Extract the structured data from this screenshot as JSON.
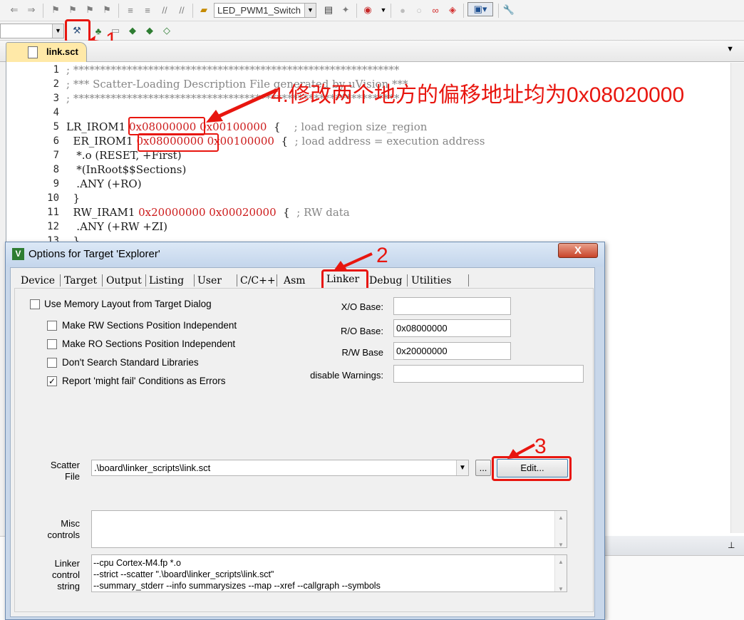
{
  "toolbar": {
    "target_combo": "LED_PWM1_Switch"
  },
  "editor": {
    "tab_label": "link.sct",
    "lines": [
      {
        "num": "1",
        "segments": [
          {
            "t": "; *************************************************************",
            "c": "cm"
          }
        ]
      },
      {
        "num": "2",
        "segments": [
          {
            "t": "; *** Scatter-Loading Description File generated by uVision ***",
            "c": "cm"
          }
        ]
      },
      {
        "num": "3",
        "segments": [
          {
            "t": "; *************************************************************",
            "c": "cm"
          }
        ]
      },
      {
        "num": "4",
        "segments": []
      },
      {
        "num": "5",
        "segments": [
          {
            "t": "LR_IROM1 ",
            "c": ""
          },
          {
            "t": "0x08000000",
            "c": "hx"
          },
          {
            "t": " ",
            "c": ""
          },
          {
            "t": "0x00100000",
            "c": "hx"
          },
          {
            "t": "  {    ",
            "c": ""
          },
          {
            "t": "; load region size_region",
            "c": "cm"
          }
        ]
      },
      {
        "num": "6",
        "segments": [
          {
            "t": "  ER_IROM1 ",
            "c": ""
          },
          {
            "t": "0x08000000",
            "c": "hx"
          },
          {
            "t": " ",
            "c": ""
          },
          {
            "t": "0x00100000",
            "c": "hx"
          },
          {
            "t": "  {  ",
            "c": ""
          },
          {
            "t": "; load address = execution address",
            "c": "cm"
          }
        ]
      },
      {
        "num": "7",
        "segments": [
          {
            "t": "   *.o (RESET, +First)",
            "c": ""
          }
        ]
      },
      {
        "num": "8",
        "segments": [
          {
            "t": "   *(InRoot$$Sections)",
            "c": ""
          }
        ]
      },
      {
        "num": "9",
        "segments": [
          {
            "t": "   .ANY (+RO)",
            "c": ""
          }
        ]
      },
      {
        "num": "10",
        "segments": [
          {
            "t": "  }",
            "c": ""
          }
        ]
      },
      {
        "num": "11",
        "segments": [
          {
            "t": "  RW_IRAM1 ",
            "c": ""
          },
          {
            "t": "0x20000000",
            "c": "hx"
          },
          {
            "t": " ",
            "c": ""
          },
          {
            "t": "0x00020000",
            "c": "hx"
          },
          {
            "t": "  {  ",
            "c": ""
          },
          {
            "t": "; RW data",
            "c": "cm"
          }
        ]
      },
      {
        "num": "12",
        "segments": [
          {
            "t": "   .ANY (+RW +ZI)",
            "c": ""
          }
        ]
      },
      {
        "num": "13",
        "segments": [
          {
            "t": "  }",
            "c": ""
          }
        ]
      }
    ]
  },
  "dialog": {
    "title": "Options for Target 'Explorer'",
    "close_glyph": "X",
    "tabs": [
      "Device",
      "Target",
      "Output",
      "Listing",
      "User",
      "C/C++",
      "Asm",
      "Linker",
      "Debug",
      "Utilities"
    ],
    "active_tab": "Linker",
    "use_memory_layout": {
      "label": "Use Memory Layout from Target Dialog",
      "checked": false
    },
    "options": [
      {
        "label": "Make RW Sections Position Independent",
        "checked": false
      },
      {
        "label": "Make RO Sections Position Independent",
        "checked": false
      },
      {
        "label": "Don't Search Standard Libraries",
        "checked": false
      },
      {
        "label": "Report 'might fail' Conditions as Errors",
        "checked": true
      }
    ],
    "xo_base_label": "X/O Base:",
    "xo_base_value": "",
    "ro_base_label": "R/O Base:",
    "ro_base_value": "0x08000000",
    "rw_base_label": "R/W Base",
    "rw_base_value": "0x20000000",
    "disable_warnings_label": "disable Warnings:",
    "disable_warnings_value": "",
    "scatter_file_label_1": "Scatter",
    "scatter_file_label_2": "File",
    "scatter_file_value": ".\\board\\linker_scripts\\link.sct",
    "browse_label": "...",
    "edit_label": "Edit...",
    "misc_label_1": "Misc",
    "misc_label_2": "controls",
    "misc_value": "",
    "linker_label_1": "Linker",
    "linker_label_2": "control",
    "linker_label_3": "string",
    "linker_string_lines": [
      "--cpu Cortex-M4.fp *.o",
      "--strict --scatter \".\\board\\linker_scripts\\link.sct\"",
      "--summary_stderr --info summarysizes --map --xref --callgraph --symbols"
    ]
  },
  "annotations": {
    "step1": "1",
    "step2": "2",
    "step3": "3",
    "step4_text": "4.修改两个地方的偏移地址均为0x08020000",
    "color": "#e8160f"
  }
}
